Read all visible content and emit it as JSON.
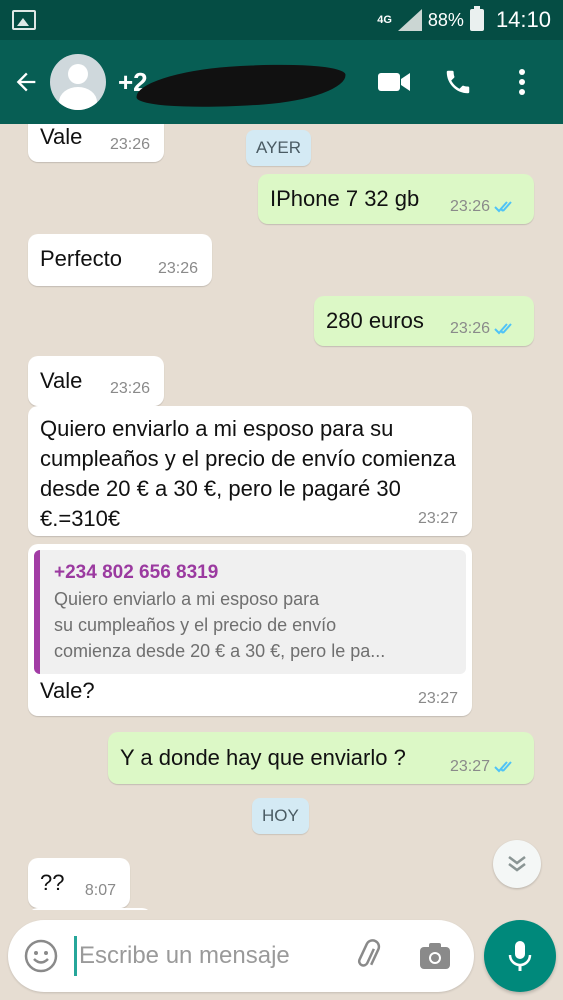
{
  "status_bar": {
    "network": "4G",
    "battery": "88%",
    "time": "14:10"
  },
  "header": {
    "contact_name": "+2"
  },
  "days": {
    "yesterday": "AYER",
    "today": "HOY"
  },
  "messages": [
    {
      "text": "Vale",
      "time": "23:26",
      "direction": "in"
    },
    {
      "text": "IPhone 7 32 gb",
      "time": "23:26",
      "direction": "out"
    },
    {
      "text": "Perfecto",
      "time": "23:26",
      "direction": "in"
    },
    {
      "text": "280 euros",
      "time": "23:26",
      "direction": "out"
    },
    {
      "text": "Vale",
      "time": "23:26",
      "direction": "in"
    },
    {
      "text": "Quiero enviarlo a mi esposo para su cumpleaños y el precio de envío comienza desde 20 € a 30 €, pero le pagaré 30 €.=310€",
      "time": "23:27",
      "direction": "in"
    },
    {
      "text": "Vale?",
      "time": "23:27",
      "direction": "in",
      "quoted": {
        "sender": "+234 802 656 8319",
        "text": "Quiero enviarlo a mi esposo para\nsu cumpleaños y el precio de envío\ncomienza desde 20 € a 30 €, pero le pa..."
      }
    },
    {
      "text": "Y a donde hay que enviarlo ?",
      "time": "23:27",
      "direction": "out"
    },
    {
      "text": "??",
      "time": "8:07",
      "direction": "in"
    }
  ],
  "composer": {
    "placeholder": "Escribe un mensaje"
  },
  "colors": {
    "header": "#075e54",
    "status_bar": "#054d44",
    "outgoing_bubble": "#dcf8c6",
    "read_ticks": "#4fc3f7",
    "mic_button": "#00897b",
    "quote_accent": "#a23ca5"
  },
  "icons": [
    "gallery-icon",
    "signal-icon",
    "battery-icon",
    "back-arrow-icon",
    "video-call-icon",
    "phone-icon",
    "more-options-icon",
    "double-check-icon",
    "chevron-down-icon",
    "emoji-icon",
    "attach-icon",
    "camera-icon",
    "mic-icon"
  ]
}
